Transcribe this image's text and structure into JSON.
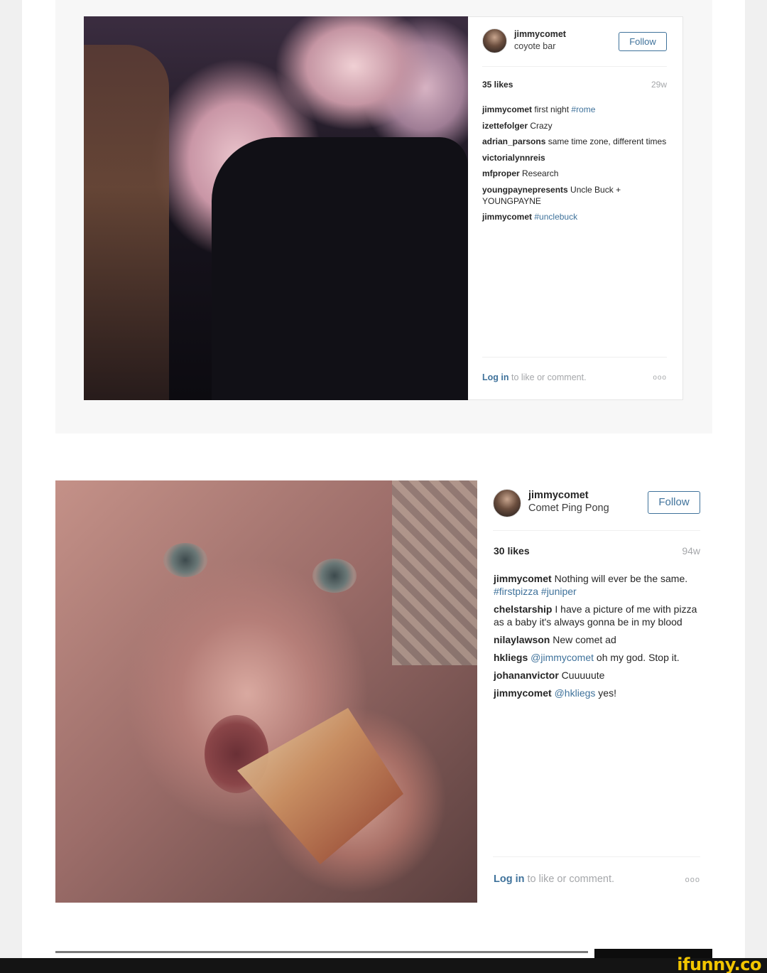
{
  "posts": [
    {
      "username": "jimmycomet",
      "location": "coyote bar",
      "follow_label": "Follow",
      "likes": "35 likes",
      "age": "29w",
      "comments": [
        {
          "user": "jimmycomet",
          "text": " first night ",
          "tag": "#rome"
        },
        {
          "user": "izettefolger",
          "text": " Crazy",
          "tag": ""
        },
        {
          "user": "adrian_parsons",
          "text": " same time zone, different times",
          "tag": ""
        },
        {
          "user": "victorialynnreis",
          "text": "",
          "tag": ""
        },
        {
          "user": "mfproper",
          "text": " Research",
          "tag": ""
        },
        {
          "user": "youngpaynepresents",
          "text": " Uncle Buck + YOUNGPAYNE",
          "tag": ""
        },
        {
          "user": "jimmycomet",
          "text": " ",
          "tag": "#unclebuck"
        }
      ],
      "login_label": "Log in",
      "login_suffix": " to like or comment.",
      "more_label": "ooo"
    },
    {
      "username": "jimmycomet",
      "location": "Comet Ping Pong",
      "follow_label": "Follow",
      "likes": "30 likes",
      "age": "94w",
      "comments": [
        {
          "user": "jimmycomet",
          "text": " Nothing will ever be the same. ",
          "tag": "#firstpizza #juniper"
        },
        {
          "user": "chelstarship",
          "text": " I have a picture of me with pizza as a baby it's always gonna be in my blood",
          "tag": ""
        },
        {
          "user": "nilaylawson",
          "text": " New comet ad",
          "tag": ""
        },
        {
          "user": "hkliegs",
          "text": " ",
          "tag": "@jimmycomet",
          "after": " oh my god. Stop it."
        },
        {
          "user": "johananvictor",
          "text": " Cuuuuute",
          "tag": ""
        },
        {
          "user": "jimmycomet",
          "text": " ",
          "tag": "@hkliegs",
          "after": " yes!"
        }
      ],
      "login_label": "Log in",
      "login_suffix": " to like or comment.",
      "more_label": "ooo"
    }
  ],
  "watermark": "ifunny.co",
  "colors": {
    "link": "#3f729b",
    "muted": "#a5a7aa",
    "watermark": "#f2c500"
  },
  "icons": {
    "avatar": "user-avatar-icon",
    "more": "more-options-icon"
  }
}
